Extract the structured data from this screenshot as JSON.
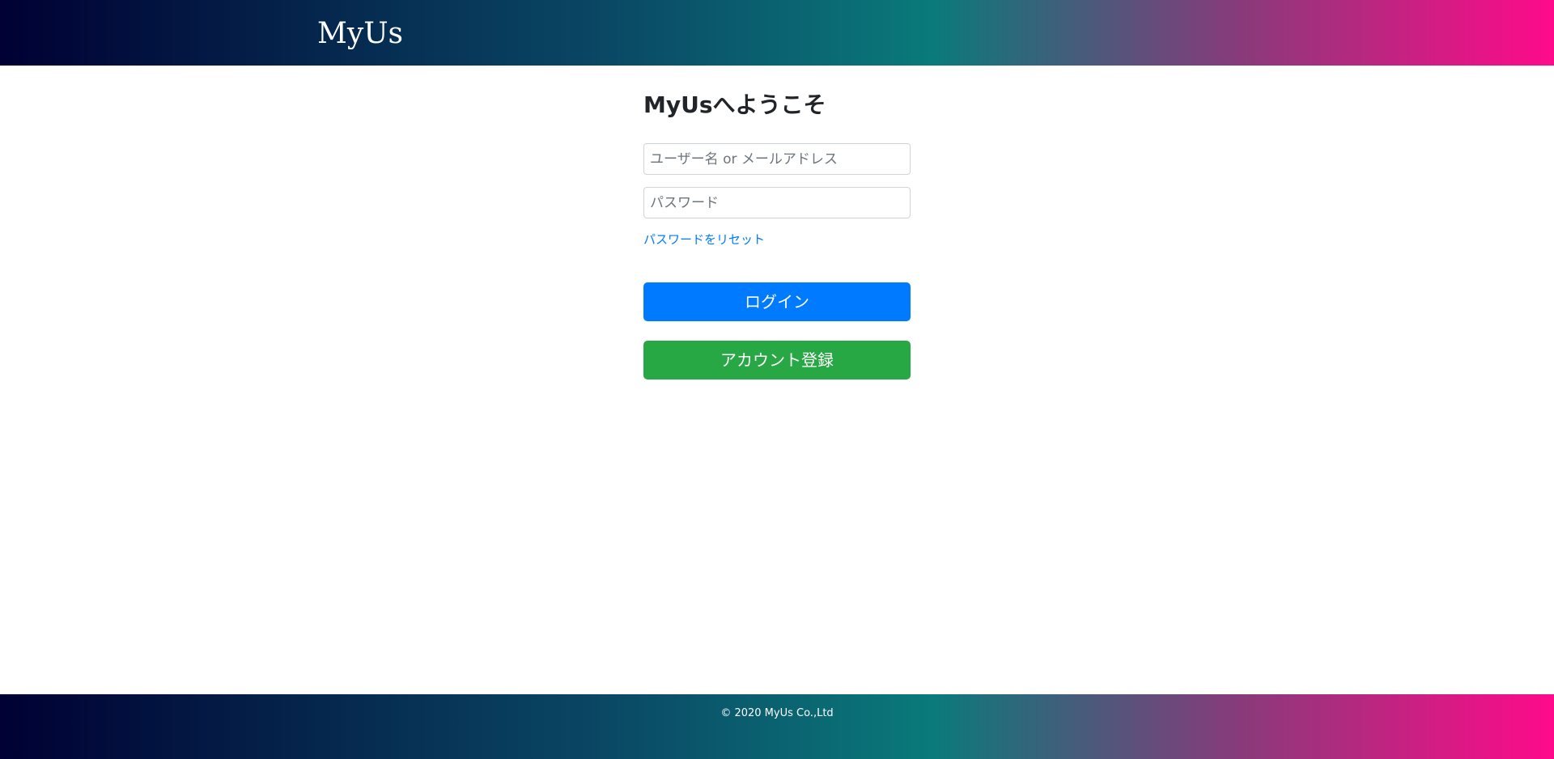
{
  "header": {
    "logo_text": "MyUs"
  },
  "login": {
    "title": "MyUsへようこそ",
    "username_placeholder": "ユーザー名 or メールアドレス",
    "password_placeholder": "パスワード",
    "reset_link_label": "パスワードをリセット",
    "login_button_label": "ログイン",
    "register_button_label": "アカウント登録"
  },
  "footer": {
    "copyright": "© 2020 MyUs Co.,Ltd"
  },
  "colors": {
    "primary": "#007bff",
    "success": "#28a745",
    "gradient_start": "#000033",
    "gradient_end": "#ff0a8a"
  }
}
